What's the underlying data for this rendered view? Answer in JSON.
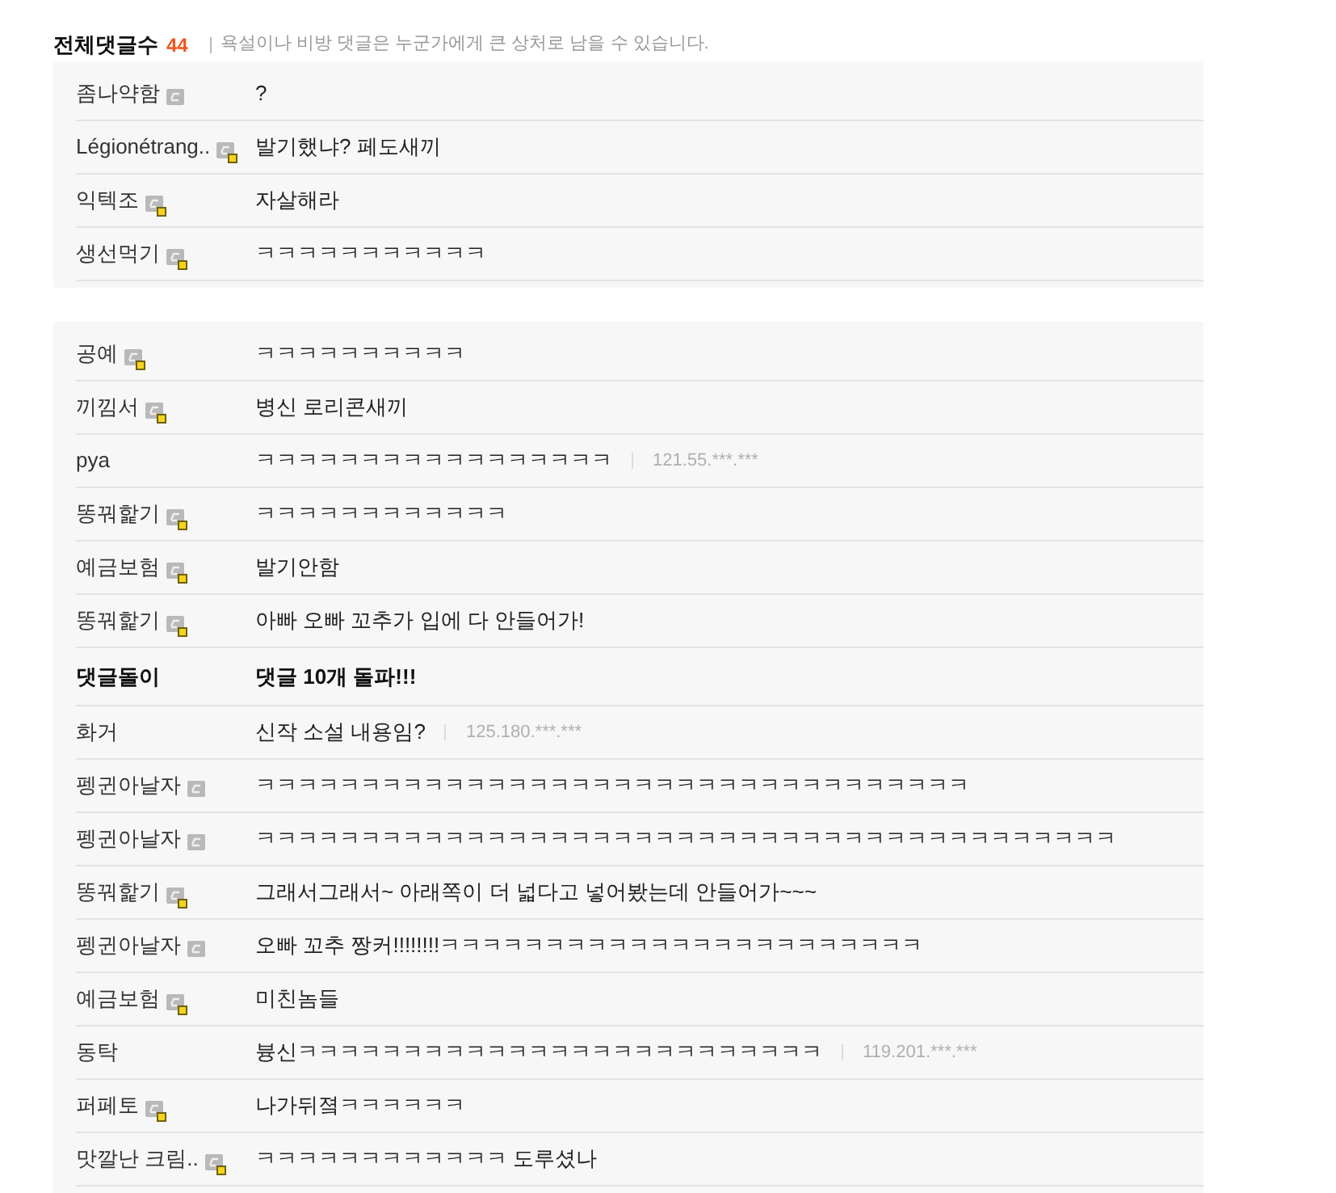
{
  "header": {
    "title": "전체댓글수",
    "count": "44",
    "notice": "욕설이나 비방 댓글은 누군가에게 큰 상처로 남을 수 있습니다."
  },
  "comment_groups": [
    {
      "comments": [
        {
          "kind": "comment",
          "author": "좀나약함",
          "badge": {
            "kind": "plain"
          },
          "text": "?"
        },
        {
          "kind": "comment",
          "author": "Légionétrang..",
          "badge": {
            "kind": "marked"
          },
          "text": "발기했냐? 페도새끼"
        },
        {
          "kind": "comment",
          "author": "익텍조",
          "badge": {
            "kind": "marked"
          },
          "text": "자살해라"
        },
        {
          "kind": "comment",
          "author": "생선먹기",
          "badge": {
            "kind": "marked"
          },
          "text": "ㅋㅋㅋㅋㅋㅋㅋㅋㅋㅋㅋ"
        }
      ]
    },
    {
      "comments": [
        {
          "kind": "comment",
          "author": "공예",
          "badge": {
            "kind": "marked"
          },
          "text": "ㅋㅋㅋㅋㅋㅋㅋㅋㅋㅋ"
        },
        {
          "kind": "comment",
          "author": "끼낌서",
          "badge": {
            "kind": "marked"
          },
          "text": "병신 로리콘새끼"
        },
        {
          "kind": "comment",
          "author": "pya",
          "text": "ㅋㅋㅋㅋㅋㅋㅋㅋㅋㅋㅋㅋㅋㅋㅋㅋㅋ",
          "ip": "121.55.***.***"
        },
        {
          "kind": "comment",
          "author": "똥꿔핥기",
          "badge": {
            "kind": "marked"
          },
          "text": "ㅋㅋㅋㅋㅋㅋㅋㅋㅋㅋㅋㅋ"
        },
        {
          "kind": "comment",
          "author": "예금보험",
          "badge": {
            "kind": "marked"
          },
          "text": "발기안함"
        },
        {
          "kind": "comment",
          "author": "똥꿔핥기",
          "badge": {
            "kind": "marked"
          },
          "text": "아빠 오빠 꼬추가 입에 다 안들어가!"
        },
        {
          "kind": "milestone",
          "author": "댓글돌이",
          "text": "댓글 10개 돌파!!!"
        },
        {
          "kind": "comment",
          "author": "화거",
          "text": "신작 소설 내용임?",
          "ip": "125.180.***.***"
        },
        {
          "kind": "comment",
          "author": "펭귄아날자",
          "badge": {
            "kind": "plain"
          },
          "text": "ㅋㅋㅋㅋㅋㅋㅋㅋㅋㅋㅋㅋㅋㅋㅋㅋㅋㅋㅋㅋㅋㅋㅋㅋㅋㅋㅋㅋㅋㅋㅋㅋㅋㅋ"
        },
        {
          "kind": "comment",
          "author": "펭귄아날자",
          "badge": {
            "kind": "plain"
          },
          "text": "ㅋㅋㅋㅋㅋㅋㅋㅋㅋㅋㅋㅋㅋㅋㅋㅋㅋㅋㅋㅋㅋㅋㅋㅋㅋㅋㅋㅋㅋㅋㅋㅋㅋㅋㅋㅋㅋㅋㅋㅋㅋ"
        },
        {
          "kind": "comment",
          "author": "똥꿔핥기",
          "badge": {
            "kind": "marked"
          },
          "text": "그래서그래서~ 아래쪽이 더 넓다고 넣어봤는데 안들어가~~~"
        },
        {
          "kind": "comment",
          "author": "펭귄아날자",
          "badge": {
            "kind": "plain"
          },
          "text": "오빠 꼬추 짱커!!!!!!!!ㅋㅋㅋㅋㅋㅋㅋㅋㅋㅋㅋㅋㅋㅋㅋㅋㅋㅋㅋㅋㅋㅋㅋ"
        },
        {
          "kind": "comment",
          "author": "예금보험",
          "badge": {
            "kind": "marked"
          },
          "text": "미친놈들"
        },
        {
          "kind": "comment",
          "author": "동탁",
          "text": "븅신ㅋㅋㅋㅋㅋㅋㅋㅋㅋㅋㅋㅋㅋㅋㅋㅋㅋㅋㅋㅋㅋㅋㅋㅋㅋ",
          "ip": "119.201.***.***"
        },
        {
          "kind": "comment",
          "author": "퍼페토",
          "badge": {
            "kind": "marked"
          },
          "text": "나가뒤졐ㅋㅋㅋㅋㅋㅋ"
        },
        {
          "kind": "comment",
          "author": "맛깔난 크림..",
          "badge": {
            "kind": "marked"
          },
          "text": "ㅋㅋㅋㅋㅋㅋㅋㅋㅋㅋㅋㅋ 도루셨나"
        }
      ]
    }
  ]
}
